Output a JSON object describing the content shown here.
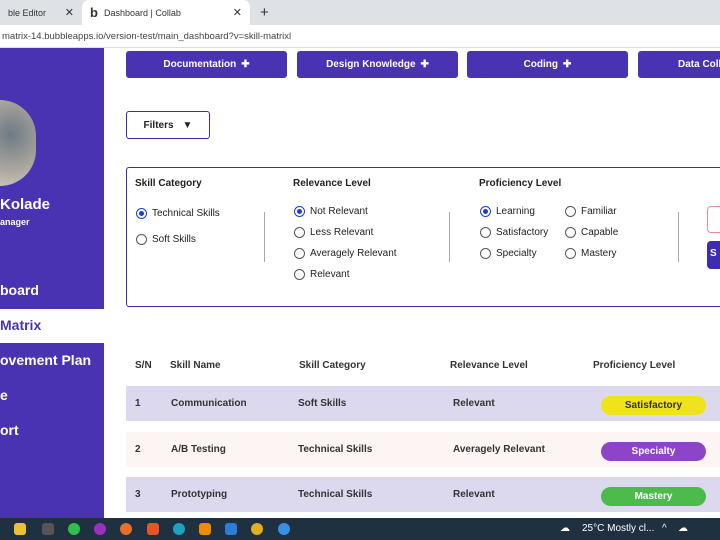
{
  "browser": {
    "tabs": [
      {
        "title": "ble Editor"
      },
      {
        "title": "Dashboard | Collab"
      }
    ],
    "new_tab": "+",
    "close": "✕",
    "url": "matrix-14.bubbleapps.io/version-test/main_dashboard?v=skill-matrixl"
  },
  "sidebar": {
    "name": "Kolade",
    "role": "anager",
    "items": [
      {
        "label": "board"
      },
      {
        "label": "Matrix"
      },
      {
        "label": "ovement Plan"
      },
      {
        "label": "e"
      },
      {
        "label": "ort"
      }
    ]
  },
  "categories": [
    {
      "label": "Documentation"
    },
    {
      "label": "Design Knowledge"
    },
    {
      "label": "Coding"
    },
    {
      "label": "Data Colle"
    }
  ],
  "filters_label": "Filters",
  "panel": {
    "skill_category": {
      "title": "Skill Category",
      "options": [
        "Technical Skills",
        "Soft Skills"
      ],
      "selected": "Technical Skills"
    },
    "relevance": {
      "title": "Relevance Level",
      "options": [
        "Not Relevant",
        "Less Relevant",
        "Averagely Relevant",
        "Relevant"
      ],
      "selected": "Not Relevant"
    },
    "proficiency": {
      "title": "Proficiency Level",
      "options": [
        "Learning",
        "Satisfactory",
        "Specialty",
        "Familiar",
        "Capable",
        "Mastery"
      ],
      "selected": "Learning"
    },
    "submit_label": "S"
  },
  "table": {
    "headers": [
      "S/N",
      "Skill Name",
      "Skill Category",
      "Relevance Level",
      "Proficiency Level"
    ],
    "rows": [
      {
        "sn": "1",
        "name": "Communication",
        "category": "Soft Skills",
        "relevance": "Relevant",
        "proficiency": "Satisfactory",
        "badge_color": "#f0e21b"
      },
      {
        "sn": "2",
        "name": "A/B Testing",
        "category": "Technical Skills",
        "relevance": "Averagely Relevant",
        "proficiency": "Specialty",
        "badge_color": "#8e44c9"
      },
      {
        "sn": "3",
        "name": "Prototyping",
        "category": "Technical Skills",
        "relevance": "Relevant",
        "proficiency": "Mastery",
        "badge_color": "#4cbb4c"
      }
    ]
  },
  "taskbar": {
    "weather": "25°C  Mostly cl...",
    "caret": "^"
  },
  "colors": {
    "accent": "#4a33b3"
  }
}
